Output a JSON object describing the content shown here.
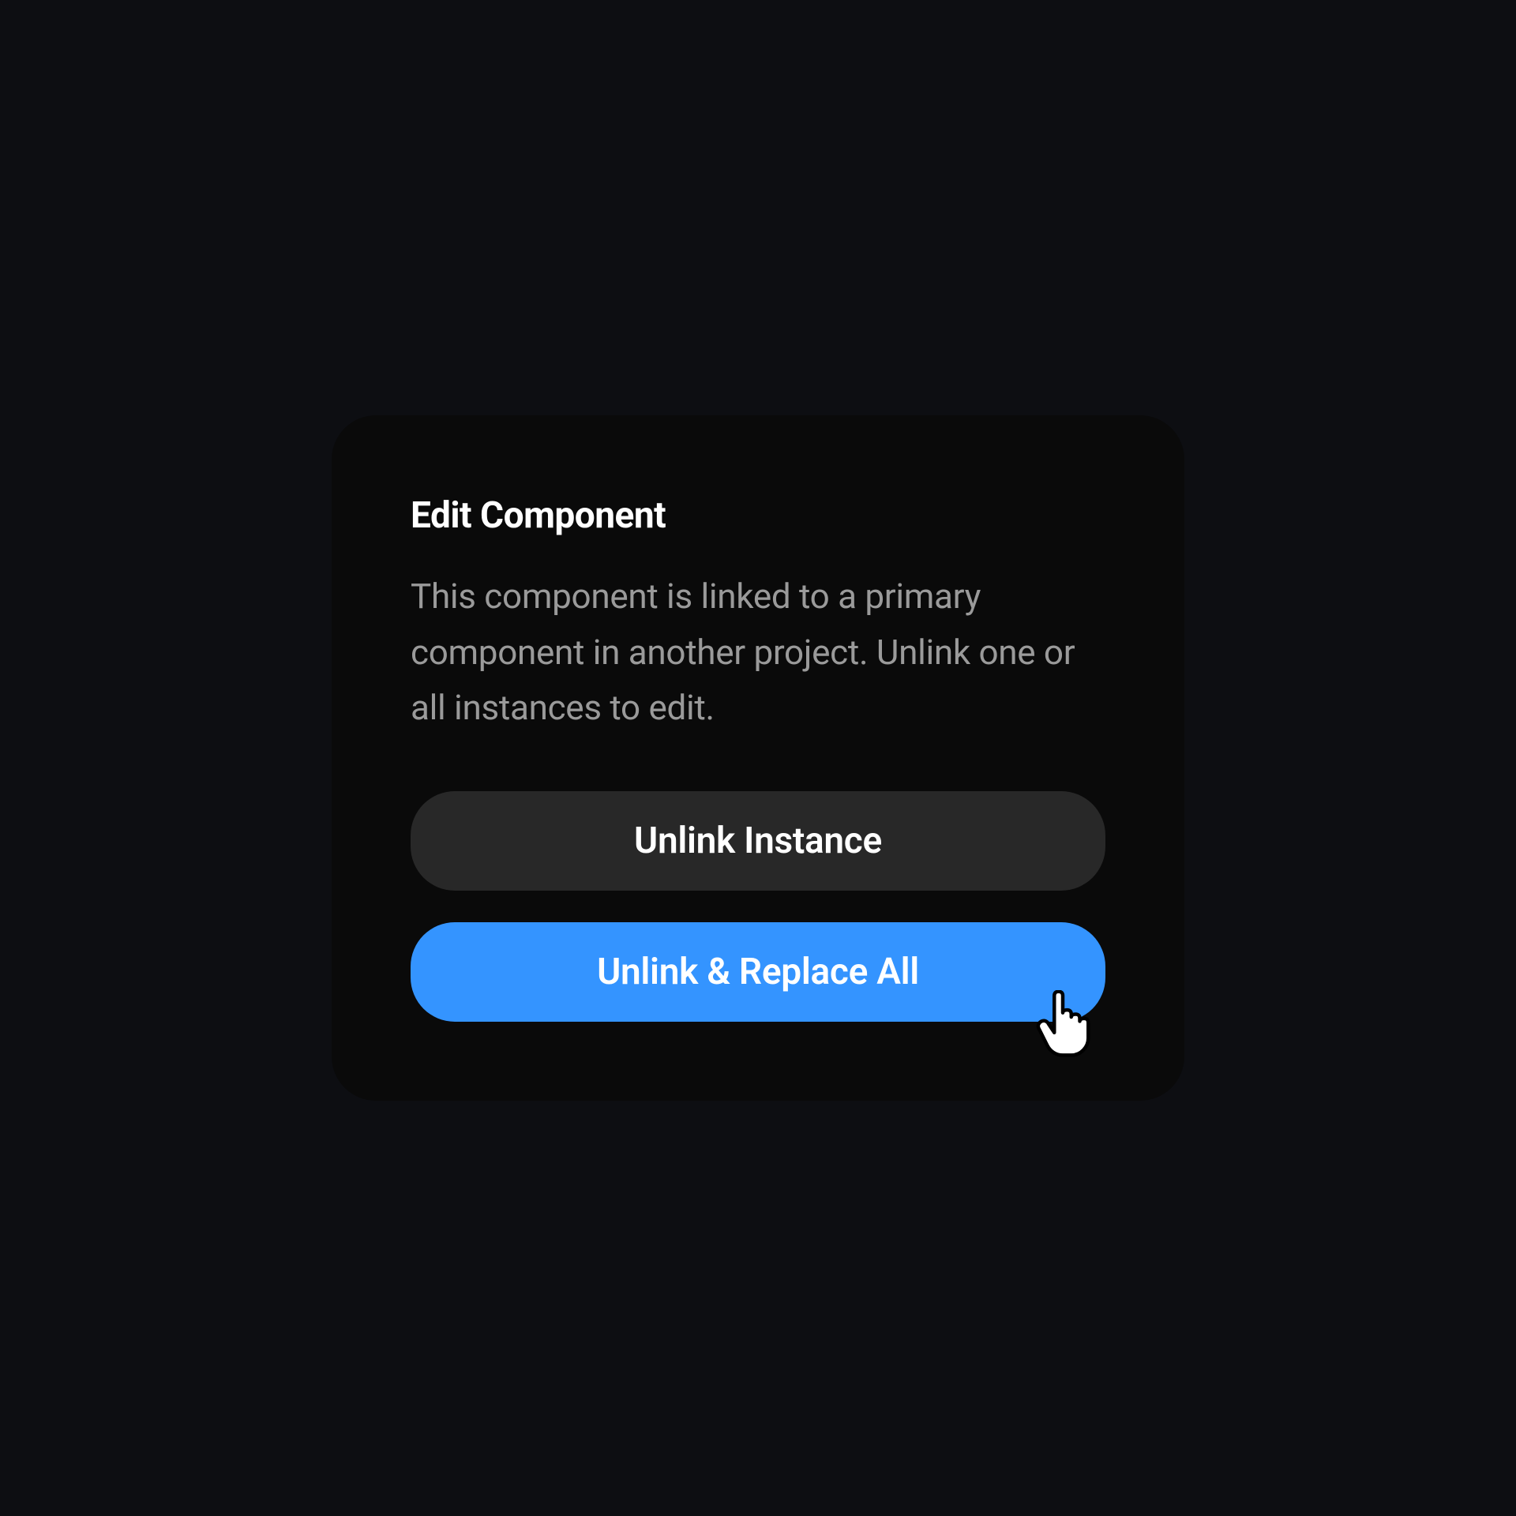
{
  "dialog": {
    "title": "Edit Component",
    "description": "This component is linked to a primary component in another project. Unlink one or all instances to edit.",
    "buttons": {
      "unlink_instance": "Unlink Instance",
      "unlink_replace_all": "Unlink & Replace All"
    }
  }
}
